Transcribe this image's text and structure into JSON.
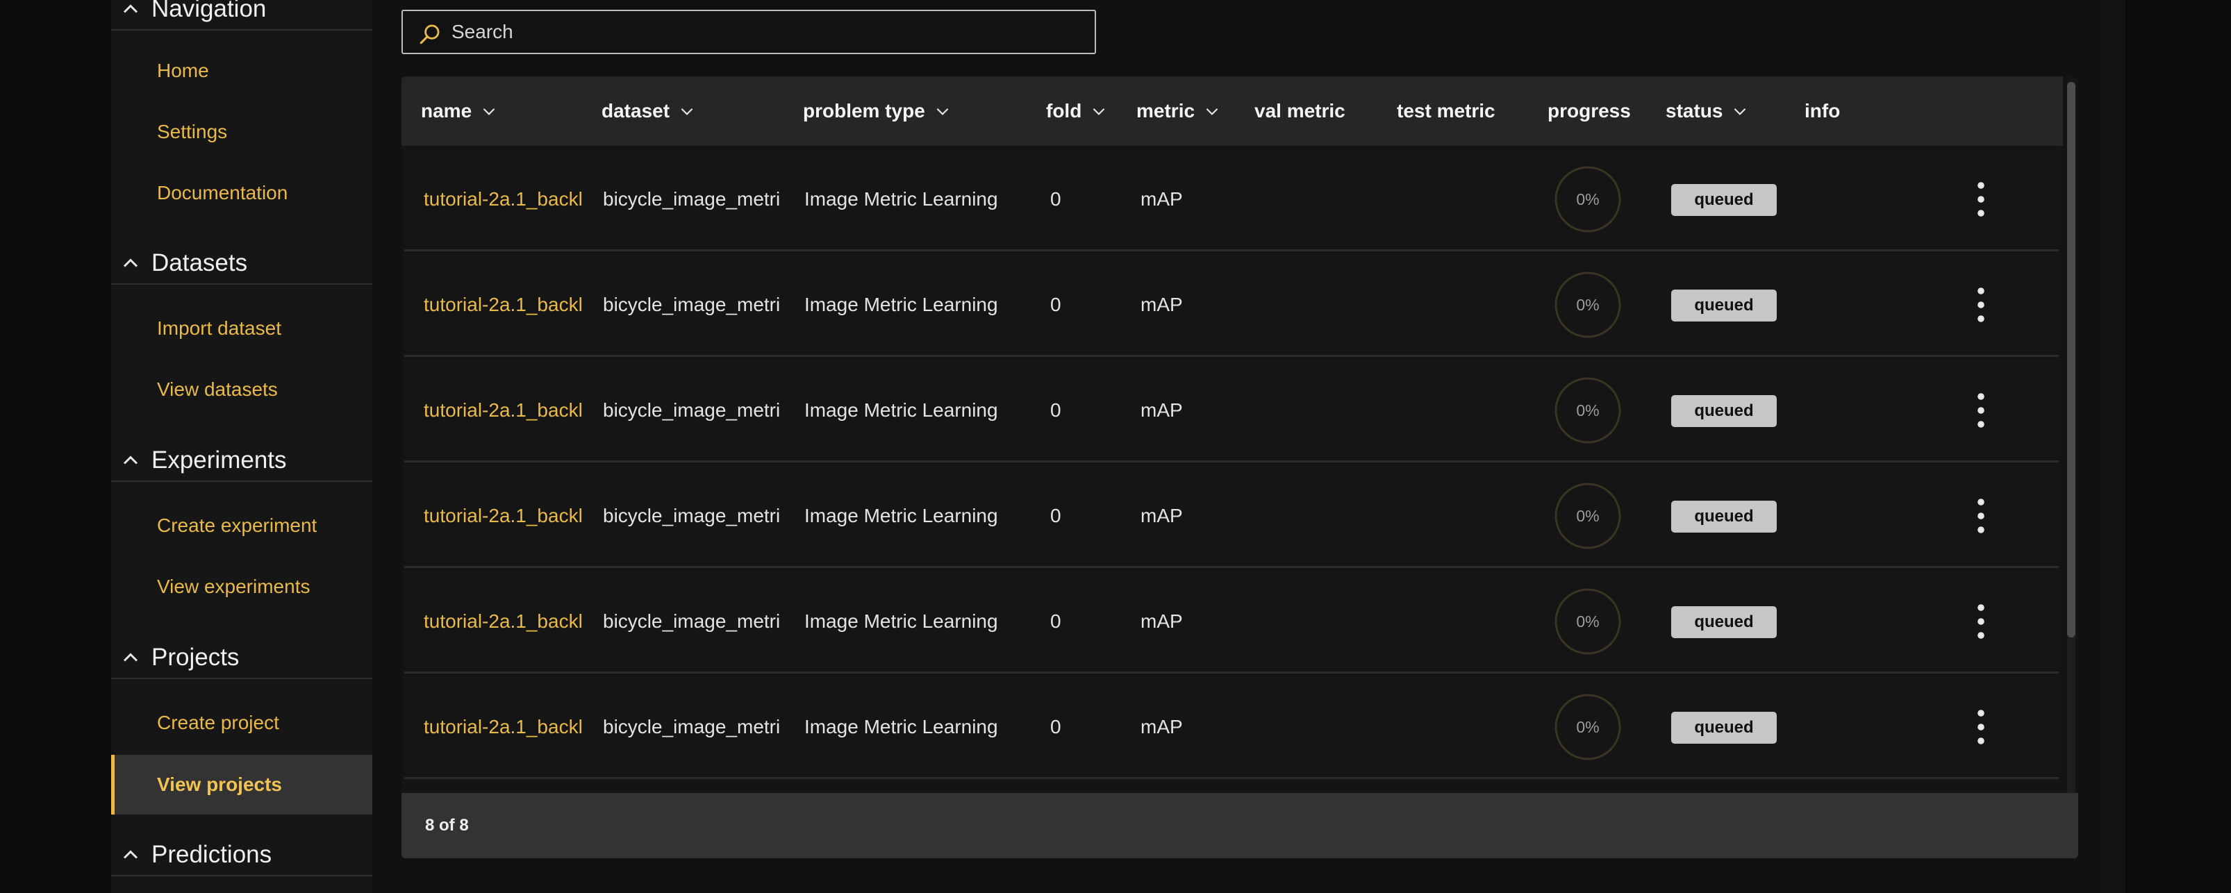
{
  "sidebar": {
    "sections": [
      {
        "title": "Navigation",
        "items": [
          "Home",
          "Settings",
          "Documentation"
        ]
      },
      {
        "title": "Datasets",
        "items": [
          "Import dataset",
          "View datasets"
        ]
      },
      {
        "title": "Experiments",
        "items": [
          "Create experiment",
          "View experiments"
        ]
      },
      {
        "title": "Projects",
        "items": [
          "Create project",
          "View projects"
        ]
      },
      {
        "title": "Predictions",
        "items": []
      }
    ],
    "active_item": "View projects"
  },
  "search": {
    "placeholder": "Search",
    "value": ""
  },
  "table": {
    "columns": [
      {
        "label": "name",
        "sortable": true
      },
      {
        "label": "dataset",
        "sortable": true
      },
      {
        "label": "problem type",
        "sortable": true
      },
      {
        "label": "fold",
        "sortable": true
      },
      {
        "label": "metric",
        "sortable": true
      },
      {
        "label": "val metric",
        "sortable": false
      },
      {
        "label": "test metric",
        "sortable": false
      },
      {
        "label": "progress",
        "sortable": false
      },
      {
        "label": "status",
        "sortable": true
      },
      {
        "label": "info",
        "sortable": false
      }
    ],
    "rows": [
      {
        "name": "tutorial-2a.1_backl",
        "dataset": "bicycle_image_metri",
        "problem_type": "Image Metric Learning",
        "fold": "0",
        "metric": "mAP",
        "val_metric": "",
        "test_metric": "",
        "progress": "0%",
        "status": "queued"
      },
      {
        "name": "tutorial-2a.1_backl",
        "dataset": "bicycle_image_metri",
        "problem_type": "Image Metric Learning",
        "fold": "0",
        "metric": "mAP",
        "val_metric": "",
        "test_metric": "",
        "progress": "0%",
        "status": "queued"
      },
      {
        "name": "tutorial-2a.1_backl",
        "dataset": "bicycle_image_metri",
        "problem_type": "Image Metric Learning",
        "fold": "0",
        "metric": "mAP",
        "val_metric": "",
        "test_metric": "",
        "progress": "0%",
        "status": "queued"
      },
      {
        "name": "tutorial-2a.1_backl",
        "dataset": "bicycle_image_metri",
        "problem_type": "Image Metric Learning",
        "fold": "0",
        "metric": "mAP",
        "val_metric": "",
        "test_metric": "",
        "progress": "0%",
        "status": "queued"
      },
      {
        "name": "tutorial-2a.1_backl",
        "dataset": "bicycle_image_metri",
        "problem_type": "Image Metric Learning",
        "fold": "0",
        "metric": "mAP",
        "val_metric": "",
        "test_metric": "",
        "progress": "0%",
        "status": "queued"
      },
      {
        "name": "tutorial-2a.1_backl",
        "dataset": "bicycle_image_metri",
        "problem_type": "Image Metric Learning",
        "fold": "0",
        "metric": "mAP",
        "val_metric": "",
        "test_metric": "",
        "progress": "0%",
        "status": "queued"
      }
    ],
    "footer_count": "8 of 8"
  },
  "colors": {
    "accent": "#e9b949",
    "background": "#111111",
    "sidebar": "#161616",
    "badge": "#c6c6c6"
  }
}
